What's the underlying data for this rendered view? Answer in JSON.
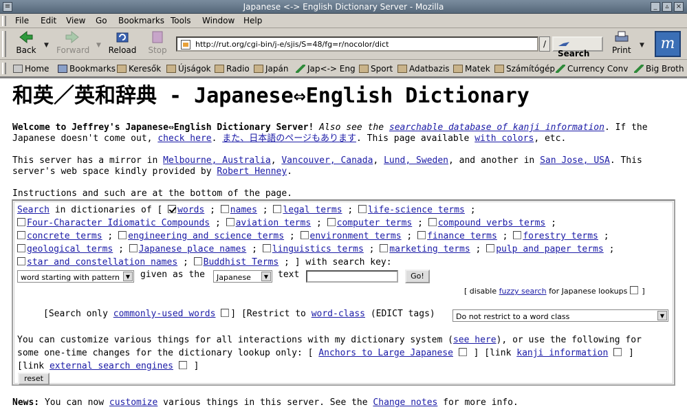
{
  "window": {
    "title": "Japanese <-> English Dictionary Server - Mozilla"
  },
  "menu": [
    "File",
    "Edit",
    "View",
    "Go",
    "Bookmarks",
    "Tools",
    "Window",
    "Help"
  ],
  "nav": {
    "back": "Back",
    "forward": "Forward",
    "reload": "Reload",
    "stop": "Stop",
    "url": "http://rut.org/cgi-bin/j-e/sjis/S=48/fg=r/nocolor/dict",
    "slash": "/",
    "search": "Search",
    "print": "Print"
  },
  "bookmarks": [
    "Home",
    "Bookmarks",
    "Keresők",
    "Újságok",
    "Radio",
    "Japán",
    "Jap<-> Eng",
    "Sport",
    "Adatbazis",
    "Matek",
    "Számítógép",
    "Currency Conv",
    "Big Broth"
  ],
  "page": {
    "heading": "和英／英和辞典 - Japanese⇔English Dictionary",
    "welcome": {
      "bold": "Welcome to Jeffrey's Japanese⇔English Dictionary Server!",
      "also": "Also see the",
      "kanji_db_link": "searchable database of kanji information",
      "mid": ". If the Japanese doesn't come out,",
      "check_link": "check here",
      "dot": ".",
      "jp_link": "また、日本語のページもあります",
      "avail": ". This page available",
      "colors_link": "with colors",
      "etc": ", etc."
    },
    "mirror": {
      "prefix": "This server has a mirror in",
      "melbourne": "Melbourne, Australia",
      "comma1": ",",
      "vancouver": "Vancouver, Canada",
      "comma2": ",",
      "lund": "Lund, Sweden",
      "another": ", and another in",
      "sanjose": "San Jose, USA",
      "space": ". This server's web space kindly provided by",
      "henney": "Robert Henney",
      "end": "."
    },
    "instructions": "Instructions and such are at the bottom of the page.",
    "form": {
      "search_link": "Search",
      "in_dicts": "in dictionaries of [",
      "dicts": [
        {
          "label": "words",
          "checked": true,
          "sep": ";"
        },
        {
          "label": "names",
          "checked": false,
          "sep": ";"
        },
        {
          "label": "legal terms",
          "checked": false,
          "sep": ";"
        },
        {
          "label": "life-science terms",
          "checked": false,
          "sep": ";"
        },
        {
          "label": "Four-Character Idiomatic Compounds",
          "checked": false,
          "sep": ";"
        },
        {
          "label": "aviation terms",
          "checked": false,
          "sep": ";"
        },
        {
          "label": "computer terms",
          "checked": false,
          "sep": ";"
        },
        {
          "label": "compound verbs terms",
          "checked": false,
          "sep": ";"
        },
        {
          "label": "concrete terms",
          "checked": false,
          "sep": ";"
        },
        {
          "label": "engineering and science terms",
          "checked": false,
          "sep": ";"
        },
        {
          "label": "environment terms",
          "checked": false,
          "sep": ";"
        },
        {
          "label": "finance terms",
          "checked": false,
          "sep": ";"
        },
        {
          "label": "forestry terms",
          "checked": false,
          "sep": ";"
        },
        {
          "label": "geological terms",
          "checked": false,
          "sep": ";"
        },
        {
          "label": "Japanese place names",
          "checked": false,
          "sep": ";"
        },
        {
          "label": "linguistics terms",
          "checked": false,
          "sep": ";"
        },
        {
          "label": "marketing terms",
          "checked": false,
          "sep": ";"
        },
        {
          "label": "pulp and paper terms",
          "checked": false,
          "sep": ";"
        },
        {
          "label": "star and constellation names",
          "checked": false,
          "sep": ";"
        },
        {
          "label": "Buddhist Terms",
          "checked": false,
          "sep": ";"
        }
      ],
      "with_key": "] with search key:",
      "match_select": "word starting with pattern",
      "given_as": "given as the",
      "lang_select": "Japanese",
      "text_label": "text",
      "text_value": "",
      "go": "Go!",
      "fuzzy_open": "[ disable",
      "fuzzy_link": "fuzzy search",
      "fuzzy_rest": "for Japanese lookups",
      "fuzzy_close": "]",
      "common_open": "[Search only",
      "common_link": "commonly-used words",
      "common_close": "]",
      "restrict_open": "[Restrict to",
      "wordclass_link": "word-class",
      "edict": "(EDICT tags)",
      "wordclass_select": "Do not restrict to a word class",
      "cust1": "You can customize various things for all interactions with my dictionary system (",
      "see_here_link": "see here",
      "cust2": "), or use the following for",
      "cust3": "some one-time changes for the dictionary lookup only: [",
      "anchors_link": "Anchors to Large Japanese",
      "link_open": "] [link",
      "kanji_info_link": "kanji information",
      "close": "]",
      "link_open2": "[link",
      "external_link": "external search engines",
      "close2": "]",
      "reset": "reset"
    },
    "news": {
      "bold": "News:",
      "t1": "You can now",
      "customize_link": "customize",
      "t2": "various things in this server. See the",
      "change_link": "Change notes",
      "t3": "for more info."
    }
  }
}
